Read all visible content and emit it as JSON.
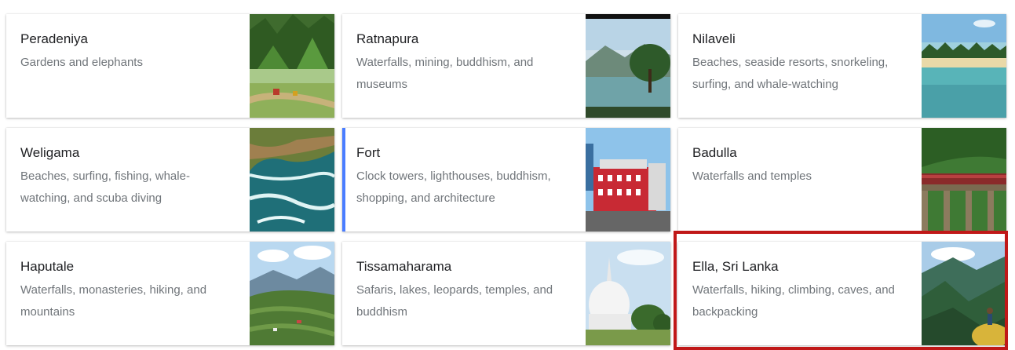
{
  "cards": [
    {
      "title": "Peradeniya",
      "description": "Gardens and elephants",
      "image_icon": "garden-photo"
    },
    {
      "title": "Ratnapura",
      "description": "Waterfalls, mining, buddhism, and museums",
      "image_icon": "lake-photo"
    },
    {
      "title": "Nilaveli",
      "description": "Beaches, seaside resorts, snorkeling, surfing, and whale-watching",
      "image_icon": "beach-photo"
    },
    {
      "title": "Weligama",
      "description": "Beaches, surfing, fishing, whale-watching, and scuba diving",
      "image_icon": "coast-aerial-photo"
    },
    {
      "title": "Fort",
      "description": "Clock towers, lighthouses, buddhism, shopping, and architecture",
      "image_icon": "red-building-photo"
    },
    {
      "title": "Badulla",
      "description": "Waterfalls and temples",
      "image_icon": "train-bridge-photo"
    },
    {
      "title": "Haputale",
      "description": "Waterfalls, monasteries, hiking, and mountains",
      "image_icon": "tea-hills-photo"
    },
    {
      "title": "Tissamaharama",
      "description": "Safaris, lakes, leopards, temples, and buddhism",
      "image_icon": "stupa-photo"
    },
    {
      "title": "Ella, Sri Lanka",
      "description": "Waterfalls, hiking, climbing, caves, and backpacking",
      "image_icon": "mountain-hiker-photo"
    }
  ],
  "colors": {
    "title": "#202124",
    "description": "#70757a",
    "accent": "#4a7dff",
    "highlight": "#c01818"
  }
}
